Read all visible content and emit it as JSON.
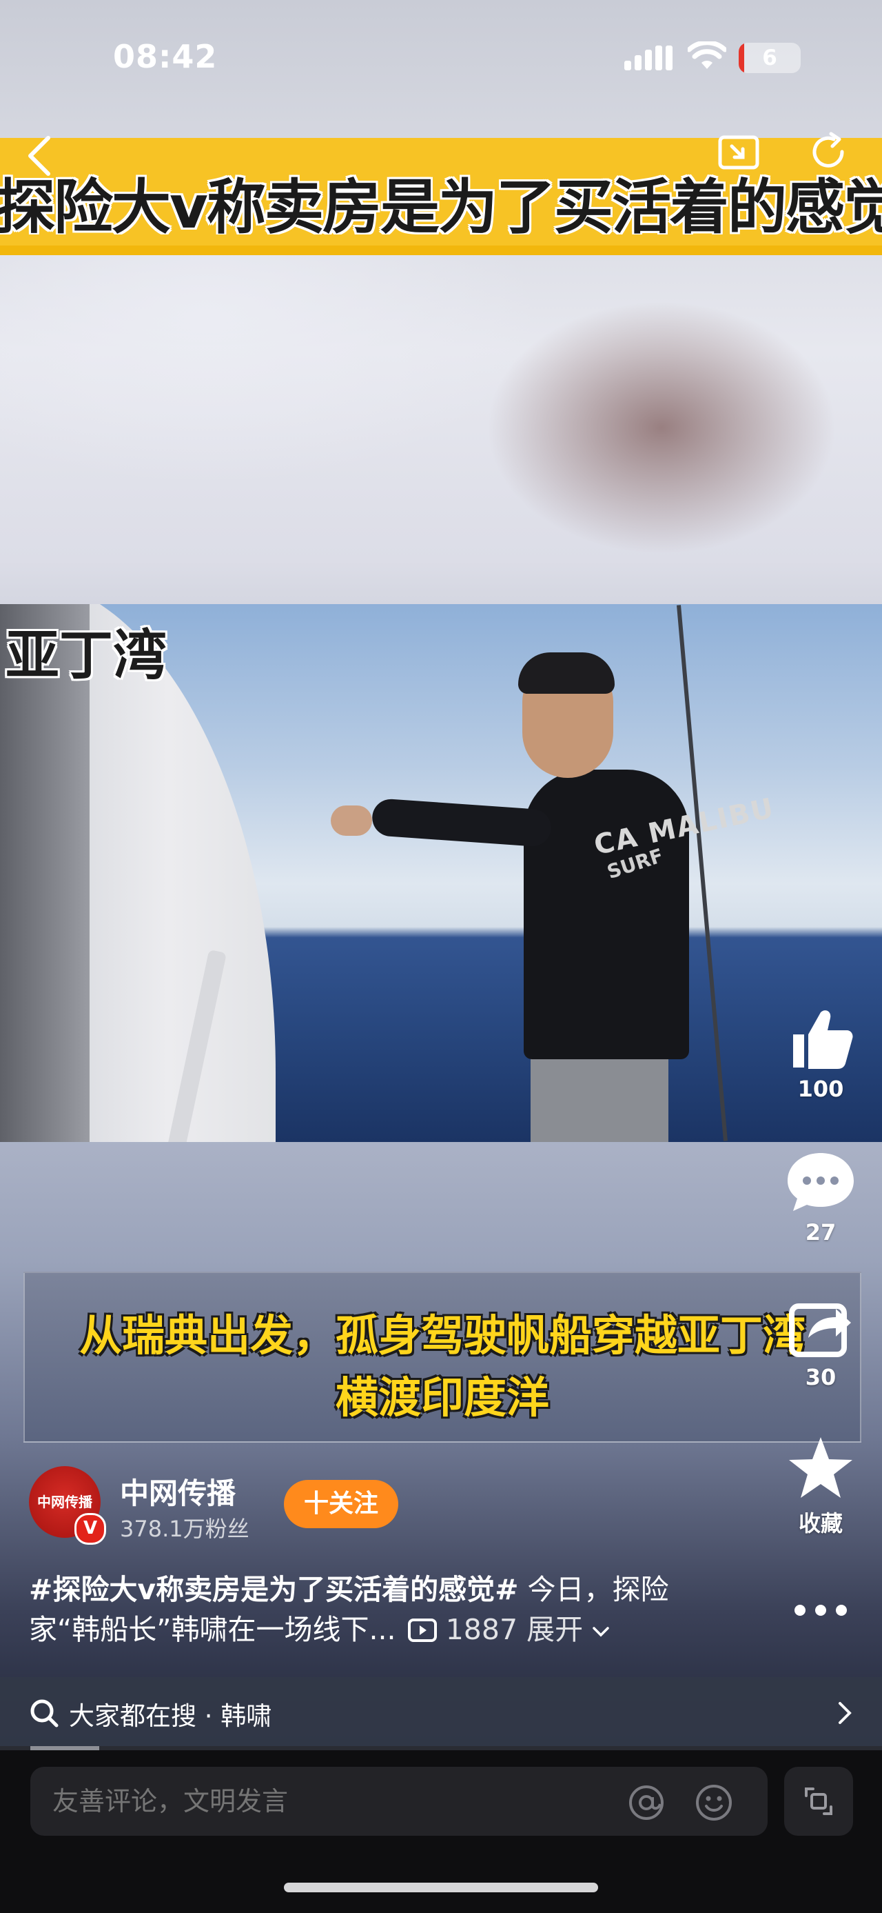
{
  "status_bar": {
    "time": "08:42",
    "battery": "6",
    "battery_color": "#e5352b"
  },
  "video": {
    "banner_title": "探险大v称卖房是为了买活着的感觉",
    "location_caption": "亚丁湾",
    "subtitle_line1": "从瑞典出发，孤身驾驶帆船穿越亚丁湾",
    "subtitle_line2": "横渡印度洋",
    "shirt_print": "CA MALIBU",
    "shirt_print2": "SURF"
  },
  "actions": {
    "like_count": "100",
    "comment_count": "27",
    "share_count": "30",
    "favorite_label": "收藏"
  },
  "author": {
    "avatar_text": "中网传播",
    "verified_badge": "V",
    "name": "中网传播",
    "fans": "378.1万粉丝",
    "follow_label": "十关注",
    "follow_color": "#ff8a1c"
  },
  "caption": {
    "hashtag": "#探险大v称卖房是为了买活着的感觉#",
    "text": " 今日，探险家“韩船长”韩啸在一场线下...",
    "views": "1887",
    "expand_label": "展开"
  },
  "search": {
    "label": "大家都在搜 · 韩啸"
  },
  "comment_bar": {
    "placeholder": "友善评论，文明发言"
  },
  "icons": [
    "back-icon",
    "pip-icon",
    "refresh-icon",
    "like-icon",
    "comment-icon",
    "share-icon",
    "star-icon",
    "more-icon",
    "search-icon",
    "chevron-right-icon",
    "at-icon",
    "emoji-icon",
    "expand-icon",
    "play-count-icon",
    "chevron-down-icon"
  ]
}
